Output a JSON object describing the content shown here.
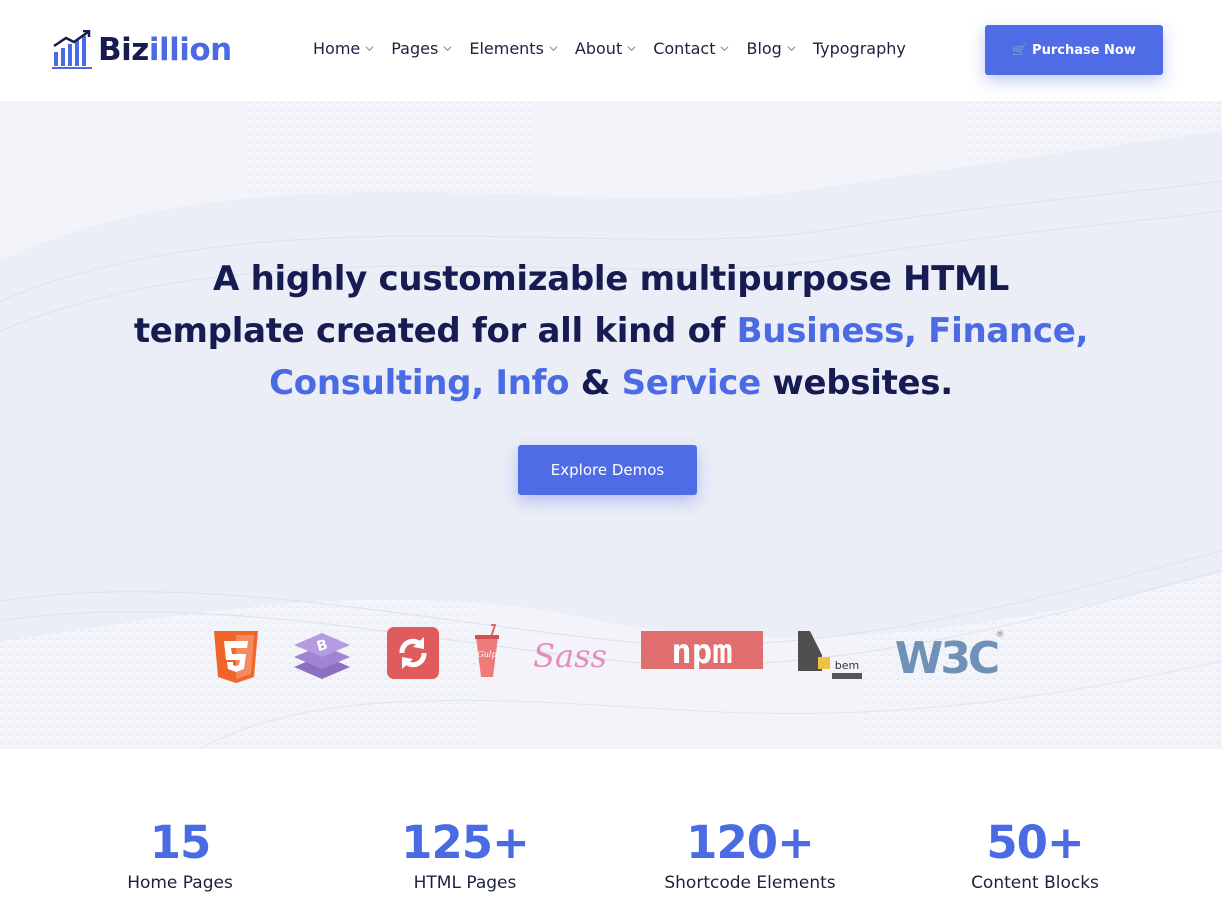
{
  "header": {
    "logo_part1": "Biz",
    "logo_part2": "illion",
    "nav": [
      {
        "label": "Home",
        "has_dropdown": true
      },
      {
        "label": "Pages",
        "has_dropdown": true
      },
      {
        "label": "Elements",
        "has_dropdown": true
      },
      {
        "label": "About",
        "has_dropdown": true
      },
      {
        "label": "Contact",
        "has_dropdown": true
      },
      {
        "label": "Blog",
        "has_dropdown": true
      },
      {
        "label": "Typography",
        "has_dropdown": false
      }
    ],
    "purchase_label": "Purchase Now",
    "purchase_icon": "cart-icon"
  },
  "hero": {
    "line1": "A highly customizable multipurpose HTML",
    "line2_a": "template created for all kind of ",
    "line2_b": "Business, Finance,",
    "line3_a": "Consulting, Info",
    "line3_b": " & ",
    "line3_c": "Service",
    "line3_d": " websites.",
    "cta_label": "Explore Demos",
    "tech_logos": [
      "html5-icon",
      "bootstrap-icon",
      "refresh-icon",
      "gulp-icon",
      "sass-icon",
      "npm-icon",
      "bem-icon",
      "w3c-icon"
    ],
    "tech_text": {
      "npm": "npm",
      "sass": "Sass",
      "bem": "bem",
      "w3c": "W3C",
      "gulp": "Gulp"
    }
  },
  "stats": [
    {
      "number": "15",
      "label": "Home Pages"
    },
    {
      "number": "125+",
      "label": "HTML Pages"
    },
    {
      "number": "120+",
      "label": "Shortcode Elements"
    },
    {
      "number": "50+",
      "label": "Content Blocks"
    }
  ],
  "colors": {
    "brand": "#4f6be6",
    "accent_text": "#4a6be3",
    "dark_text": "#161c52",
    "hero_bg": "#f3f4fa"
  }
}
